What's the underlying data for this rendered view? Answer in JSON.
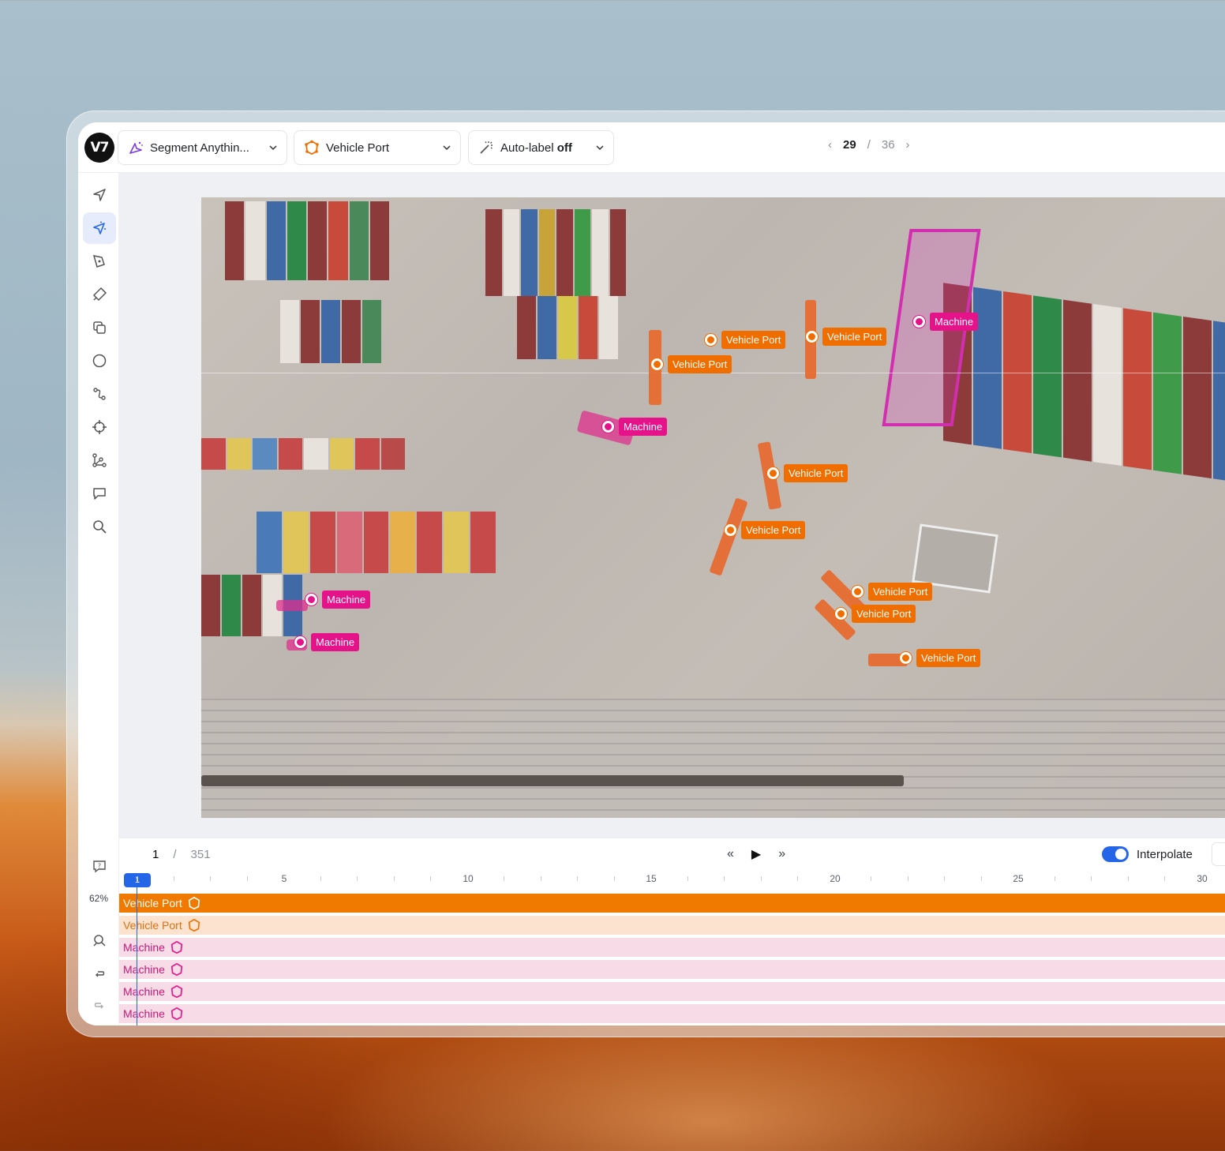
{
  "toolbar": {
    "tool_select": "Segment Anythin...",
    "class_select": "Vehicle Port",
    "autolabel_prefix": "Auto-label",
    "autolabel_state": "off",
    "logo": "V7",
    "page_current": "29",
    "page_sep": "/",
    "page_total": "36"
  },
  "rail": {
    "tools": [
      "navigate-icon",
      "segment-anything-icon",
      "pen-icon",
      "brush-icon",
      "polygon-copy-icon",
      "ellipse-icon",
      "polyline-icon",
      "keypoint-icon",
      "skeleton-icon",
      "comment-icon",
      "search-icon"
    ],
    "active_tool": "segment-anything-icon",
    "zoom": "62%"
  },
  "annotations": [
    {
      "class": "Vehicle Port"
    },
    {
      "class": "Vehicle Port"
    },
    {
      "class": "Vehicle Port"
    },
    {
      "class": "Machine"
    },
    {
      "class": "Machine"
    },
    {
      "class": "Vehicle Port"
    },
    {
      "class": "Vehicle Port"
    },
    {
      "class": "Machine"
    },
    {
      "class": "Machine"
    },
    {
      "class": "Vehicle Port"
    },
    {
      "class": "Vehicle Port"
    },
    {
      "class": "Vehicle Port"
    }
  ],
  "timeline": {
    "frame_current": "1",
    "frame_sep": "/",
    "frame_total": "351",
    "rewind": "«",
    "play": "▶",
    "forward": "»",
    "interpolate_label": "Interpolate",
    "interpolate_on": true,
    "cursor_frame": "1",
    "ruler_labels": [
      "5",
      "10",
      "15",
      "20",
      "25",
      "30"
    ],
    "tracks": [
      {
        "label": "Vehicle Port",
        "state": "selected"
      },
      {
        "label": "Vehicle Port",
        "state": "normal"
      },
      {
        "label": "Machine",
        "state": "normal"
      },
      {
        "label": "Machine",
        "state": "normal"
      },
      {
        "label": "Machine",
        "state": "normal"
      },
      {
        "label": "Machine",
        "state": "normal"
      }
    ]
  },
  "colors": {
    "vehicle_port": "#f06d00",
    "machine": "#e6128a",
    "accent": "#2566e8"
  }
}
